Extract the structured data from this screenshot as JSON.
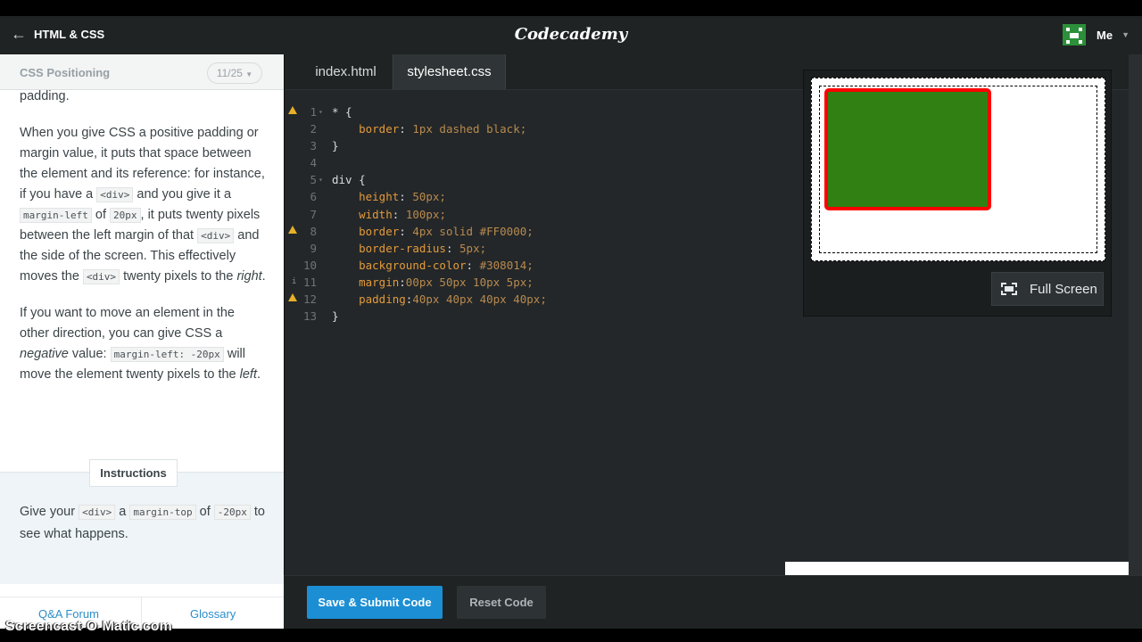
{
  "header": {
    "back_label": "HTML & CSS",
    "logo": "Codecademy",
    "user_label": "Me"
  },
  "lesson": {
    "title": "CSS Positioning",
    "progress": "11/25",
    "p0": "padding.",
    "p1_a": "When you give CSS a positive padding or margin value, it puts that space between the element and its reference: for instance, if you have a",
    "p1_code1": "<div>",
    "p1_b": "and you give it a",
    "p1_code2": "margin-left",
    "p1_c": "of",
    "p1_code3": "20px",
    "p1_d": ", it puts twenty pixels between the left margin of that",
    "p1_code4": "<div>",
    "p1_e": "and the side of the screen. This effectively moves the",
    "p1_code5": "<div>",
    "p1_f": "twenty pixels to the",
    "p1_em": "right",
    "p1_g": ".",
    "p2_a": "If you want to move an element in the other direction, you can give CSS a",
    "p2_em1": "negative",
    "p2_b": "value:",
    "p2_code": "margin-left: -20px",
    "p2_c": "will move the element twenty pixels to the",
    "p2_em2": "left",
    "p2_d": ".",
    "instructions_label": "Instructions",
    "instr_a": "Give your",
    "instr_code1": "<div>",
    "instr_b": "a",
    "instr_code2": "margin-top",
    "instr_c": "of",
    "instr_code3": "-20px",
    "instr_d": "to see what happens.",
    "forum_link": "Q&A Forum",
    "glossary_link": "Glossary"
  },
  "editor": {
    "tabs": [
      "index.html",
      "stylesheet.css"
    ],
    "lines": [
      {
        "n": "1",
        "t": "* {"
      },
      {
        "n": "2",
        "t": "    border: 1px dashed black;"
      },
      {
        "n": "3",
        "t": "}"
      },
      {
        "n": "4",
        "t": ""
      },
      {
        "n": "5",
        "t": "div {"
      },
      {
        "n": "6",
        "t": "    height: 50px;"
      },
      {
        "n": "7",
        "t": "    width: 100px;"
      },
      {
        "n": "8",
        "t": "    border: 4px solid #FF0000;"
      },
      {
        "n": "9",
        "t": "    border-radius: 5px;"
      },
      {
        "n": "10",
        "t": "    background-color: #308014;"
      },
      {
        "n": "11",
        "t": "    margin:00px 50px 10px 5px;"
      },
      {
        "n": "12",
        "t": "    padding:40px 40px 40px 40px;"
      },
      {
        "n": "13",
        "t": "}"
      }
    ],
    "fullscreen_label": "Full Screen"
  },
  "actions": {
    "submit_label": "Save & Submit Code",
    "reset_label": "Reset Code"
  },
  "watermark": "Screencast-O-Matic.com",
  "colors": {
    "accent": "#1c8fd4",
    "div_bg": "#308014",
    "div_border": "#FF0000"
  }
}
